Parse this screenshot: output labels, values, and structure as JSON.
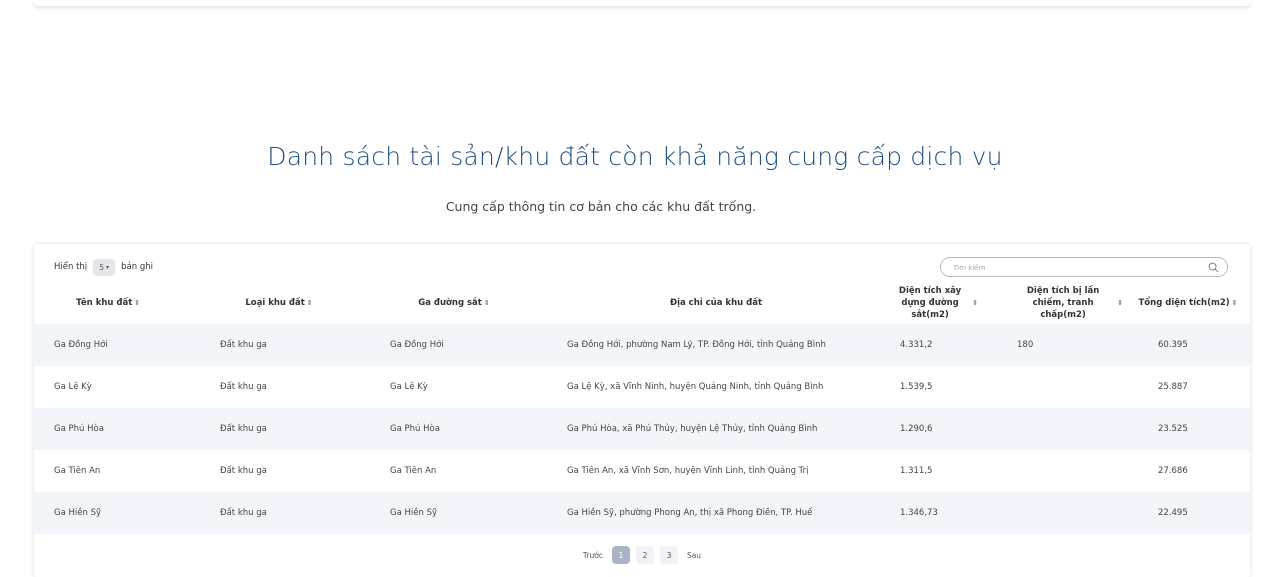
{
  "page": {
    "title": "Danh sách tài sản/khu đất còn khả năng cung cấp dịch vụ",
    "subtitle": "Cung cấp thông tin cơ bản cho các khu đất trống."
  },
  "table_controls": {
    "show_label": "Hiển thị",
    "page_size": "5",
    "records_label": "bản ghi",
    "search_placeholder": "Tìm kiếm"
  },
  "table": {
    "columns": [
      "Tên khu đất",
      "Loại khu đất",
      "Ga đường sắt",
      "Địa chỉ của khu đất",
      "Diện tích xây dựng đường sắt(m2)",
      "Diện tích bị lấn chiếm, tranh chấp(m2)",
      "Tổng diện tích(m2)"
    ],
    "rows": [
      [
        "Ga Đồng Hới",
        "Đất khu ga",
        "Ga Đồng Hới",
        "Ga Đồng Hới, phường Nam Lý, TP. Đồng Hới, tỉnh Quảng Bình",
        "4.331,2",
        "180",
        "60.395"
      ],
      [
        "Ga Lệ Kỳ",
        "Đất khu ga",
        "Ga Lệ Kỳ",
        "Ga Lệ Kỳ, xã Vĩnh Ninh, huyện Quảng Ninh, tỉnh Quảng Bình",
        "1.539,5",
        "",
        "25.887"
      ],
      [
        "Ga Phú Hòa",
        "Đất khu ga",
        "Ga Phú Hòa",
        "Ga Phú Hòa, xã Phú Thủy, huyện Lệ Thủy, tỉnh Quảng Bình",
        "1.290,6",
        "",
        "23.525"
      ],
      [
        "Ga Tiên An",
        "Đất khu ga",
        "Ga Tiên An",
        "Ga Tiên An, xã Vĩnh Sơn, huyện Vĩnh Linh, tỉnh Quảng Trị",
        "1.311,5",
        "",
        "27.686"
      ],
      [
        "Ga Hiền Sỹ",
        "Đất khu ga",
        "Ga Hiền Sỹ",
        "Ga Hiền Sỹ, phường Phong An, thị xã Phong Điền, TP. Huế",
        "1.346,73",
        "",
        "22.495"
      ]
    ]
  },
  "pagination": {
    "prev": "Trước",
    "pages": [
      "1",
      "2",
      "3"
    ],
    "current": "1",
    "next": "Sau"
  },
  "icons": {
    "search": "search-icon",
    "sort": "sort-icon",
    "dropdown": "chevron-down-icon"
  },
  "colors": {
    "title": "#1d4f80",
    "row_stripe": "#f2f5f9",
    "active_page": "#aab4c6"
  }
}
